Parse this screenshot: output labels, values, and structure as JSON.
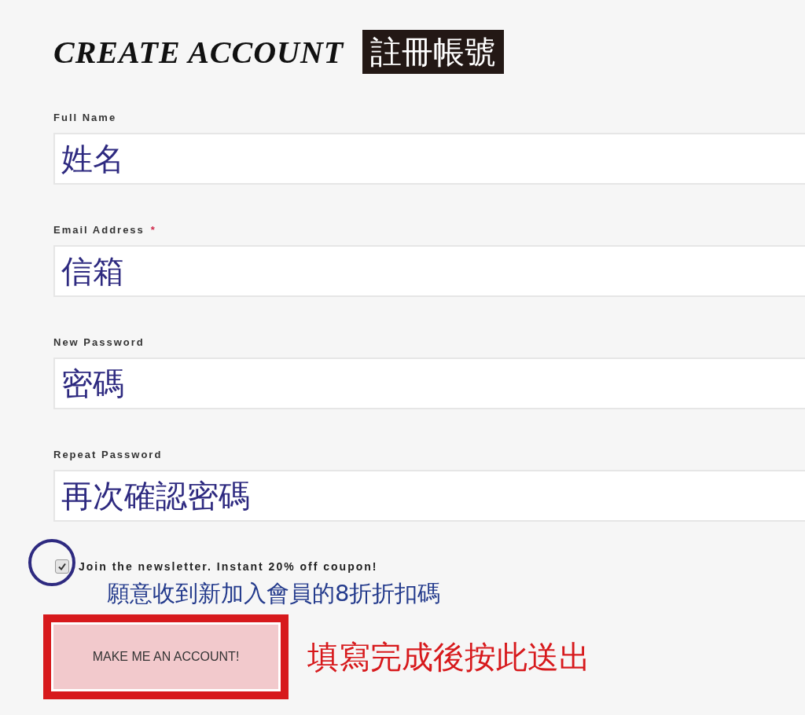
{
  "header": {
    "title": "CREATE ACCOUNT",
    "annotation": "註冊帳號"
  },
  "required_mark": "*",
  "fields": [
    {
      "label": "Full Name",
      "required": false,
      "value": "姓名"
    },
    {
      "label": "Email Address",
      "required": true,
      "value": "信箱"
    },
    {
      "label": "New Password",
      "required": false,
      "value": "密碼"
    },
    {
      "label": "Repeat Password",
      "required": false,
      "value": "再次確認密碼"
    }
  ],
  "newsletter": {
    "checked": true,
    "label": "Join the newsletter. Instant 20% off coupon!",
    "annotation": "願意收到新加入會員的8折折扣碼"
  },
  "submit": {
    "label": "MAKE ME AN ACCOUNT!",
    "annotation": "填寫完成後按此送出"
  }
}
